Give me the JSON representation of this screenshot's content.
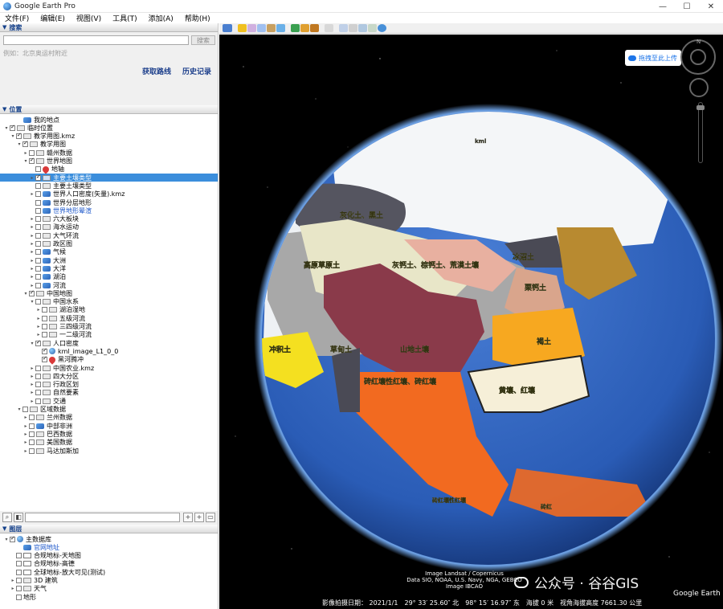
{
  "window": {
    "title": "Google Earth Pro",
    "controls": [
      "—",
      "☐",
      "✕"
    ]
  },
  "menu": [
    "文件(F)",
    "编辑(E)",
    "视图(V)",
    "工具(T)",
    "添加(A)",
    "帮助(H)"
  ],
  "search": {
    "header": "搜索",
    "button": "搜索",
    "hint": "例如：北京奥运村附近",
    "links": [
      "获取路线",
      "历史记录"
    ]
  },
  "places": {
    "header": "位置",
    "items": [
      {
        "label": "我的地点",
        "indent": 1,
        "icon": "layer",
        "expander": "",
        "check": "none"
      },
      {
        "label": "临时位置",
        "indent": 0,
        "icon": "folder",
        "expander": "▾",
        "check": "checked"
      },
      {
        "label": "教学用图.kmz",
        "indent": 1,
        "icon": "folder",
        "expander": "▾",
        "check": "checked"
      },
      {
        "label": "教学用图",
        "indent": 2,
        "icon": "folder",
        "expander": "▾",
        "check": "checked"
      },
      {
        "label": "赣州数据",
        "indent": 3,
        "icon": "folder",
        "expander": "▸",
        "check": "unchecked"
      },
      {
        "label": "世界地图",
        "indent": 3,
        "icon": "folder",
        "expander": "▾",
        "check": "checked"
      },
      {
        "label": "地轴",
        "indent": 4,
        "icon": "pin",
        "expander": "",
        "check": "unchecked"
      },
      {
        "label": "主要土壤类型",
        "indent": 4,
        "icon": "folder",
        "expander": "▸",
        "check": "checked",
        "selected": true
      },
      {
        "label": "主要土壤类型",
        "indent": 4,
        "icon": "folder",
        "expander": "",
        "check": "unchecked"
      },
      {
        "label": "世界人口密度(矢量).kmz",
        "indent": 4,
        "icon": "layer",
        "expander": "▸",
        "check": "unchecked"
      },
      {
        "label": "世界分层地形",
        "indent": 4,
        "icon": "layer",
        "expander": "",
        "check": "unchecked"
      },
      {
        "label": "世界地形晕渲",
        "indent": 4,
        "icon": "layer",
        "expander": "",
        "check": "unchecked",
        "blue": true
      },
      {
        "label": "六大板块",
        "indent": 4,
        "icon": "folder",
        "expander": "▸",
        "check": "unchecked"
      },
      {
        "label": "海水运动",
        "indent": 4,
        "icon": "folder",
        "expander": "▸",
        "check": "unchecked"
      },
      {
        "label": "大气环流",
        "indent": 4,
        "icon": "folder",
        "expander": "▸",
        "check": "unchecked"
      },
      {
        "label": "政区图",
        "indent": 4,
        "icon": "folder",
        "expander": "▸",
        "check": "unchecked"
      },
      {
        "label": "气候",
        "indent": 4,
        "icon": "layer",
        "expander": "▸",
        "check": "unchecked"
      },
      {
        "label": "大洲",
        "indent": 4,
        "icon": "layer",
        "expander": "▸",
        "check": "unchecked"
      },
      {
        "label": "大洋",
        "indent": 4,
        "icon": "layer",
        "expander": "▸",
        "check": "unchecked"
      },
      {
        "label": "湖泊",
        "indent": 4,
        "icon": "layer",
        "expander": "▸",
        "check": "unchecked"
      },
      {
        "label": "河流",
        "indent": 4,
        "icon": "layer",
        "expander": "▸",
        "check": "unchecked"
      },
      {
        "label": "中国地图",
        "indent": 3,
        "icon": "folder",
        "expander": "▾",
        "check": "checked"
      },
      {
        "label": "中国水系",
        "indent": 4,
        "icon": "folder",
        "expander": "▾",
        "check": "unchecked"
      },
      {
        "label": "湖泊湿地",
        "indent": 5,
        "icon": "folder",
        "expander": "▸",
        "check": "unchecked"
      },
      {
        "label": "五级河流",
        "indent": 5,
        "icon": "folder",
        "expander": "▸",
        "check": "unchecked"
      },
      {
        "label": "三四级河流",
        "indent": 5,
        "icon": "folder",
        "expander": "▸",
        "check": "unchecked"
      },
      {
        "label": "一二级河流",
        "indent": 5,
        "icon": "folder",
        "expander": "▸",
        "check": "unchecked"
      },
      {
        "label": "人口密度",
        "indent": 4,
        "icon": "folder",
        "expander": "▾",
        "check": "checked"
      },
      {
        "label": "kml_image_L1_0_0",
        "indent": 5,
        "icon": "globe",
        "expander": "",
        "check": "checked"
      },
      {
        "label": "黑河腾冲",
        "indent": 5,
        "icon": "pin",
        "expander": "",
        "check": "checked"
      },
      {
        "label": "中国农业.kmz",
        "indent": 4,
        "icon": "folder",
        "expander": "▸",
        "check": "unchecked"
      },
      {
        "label": "四大分区",
        "indent": 4,
        "icon": "folder",
        "expander": "▸",
        "check": "unchecked"
      },
      {
        "label": "行政区划",
        "indent": 4,
        "icon": "folder",
        "expander": "▸",
        "check": "unchecked"
      },
      {
        "label": "自然要素",
        "indent": 4,
        "icon": "folder",
        "expander": "▸",
        "check": "unchecked"
      },
      {
        "label": "交通",
        "indent": 4,
        "icon": "folder",
        "expander": "▸",
        "check": "unchecked"
      },
      {
        "label": "区域数据",
        "indent": 2,
        "icon": "folder",
        "expander": "▾",
        "check": "unchecked"
      },
      {
        "label": "兰州数据",
        "indent": 3,
        "icon": "folder",
        "expander": "▸",
        "check": "unchecked"
      },
      {
        "label": "中部非洲",
        "indent": 3,
        "icon": "layer",
        "expander": "▸",
        "check": "unchecked"
      },
      {
        "label": "巴西数据",
        "indent": 3,
        "icon": "folder",
        "expander": "▸",
        "check": "unchecked"
      },
      {
        "label": "美国数据",
        "indent": 3,
        "icon": "folder",
        "expander": "▸",
        "check": "unchecked"
      },
      {
        "label": "马达加斯加",
        "indent": 3,
        "icon": "folder",
        "expander": "▸",
        "check": "unchecked"
      }
    ]
  },
  "layers": {
    "header": "图层",
    "items": [
      {
        "label": "主数据库",
        "indent": 0,
        "icon": "globe",
        "expander": "▾",
        "check": "checked"
      },
      {
        "label": "官网地址",
        "indent": 1,
        "icon": "layer",
        "expander": "",
        "check": "none",
        "blue": true
      },
      {
        "label": "合规地标-天地图",
        "indent": 1,
        "icon": "img",
        "expander": "",
        "check": "unchecked"
      },
      {
        "label": "合规地标-高德",
        "indent": 1,
        "icon": "img",
        "expander": "",
        "check": "unchecked"
      },
      {
        "label": "全球地标-放大可见(测试)",
        "indent": 1,
        "icon": "img",
        "expander": "",
        "check": "unchecked"
      },
      {
        "label": "3D 建筑",
        "indent": 1,
        "icon": "folder",
        "expander": "▸",
        "check": "unchecked"
      },
      {
        "label": "天气",
        "indent": 1,
        "icon": "folder",
        "expander": "▸",
        "check": "unchecked"
      },
      {
        "label": "地形",
        "indent": 1,
        "icon": "none",
        "expander": "",
        "check": "unchecked"
      }
    ]
  },
  "map": {
    "upload_button": "拖拽至此上传",
    "compass_n": "N",
    "regions": [
      {
        "label": "冰沼土",
        "fill": "#4a4a55"
      },
      {
        "label": "灰钙土、棕钙土、荒漠土壤",
        "fill": "#e8b0a0"
      },
      {
        "label": "灰化土、黑土",
        "fill": "#555560"
      },
      {
        "label": "栗钙土",
        "fill": "#d9a58c"
      },
      {
        "label": "褐土",
        "fill": "#f7a820"
      },
      {
        "label": "黄壤、红壤",
        "fill": "#f6efd8"
      },
      {
        "label": "山地土壤",
        "fill": "#8a3a4a"
      },
      {
        "label": "砖红壤性红壤、砖红壤",
        "fill": "#f26a20"
      },
      {
        "label": "高原草原土",
        "fill": "#e8e6c8"
      },
      {
        "label": "冲积土",
        "fill": "#f4e020"
      },
      {
        "label": "草甸土",
        "fill": "#a8a8a8"
      },
      {
        "label": "砖红壤性红壤",
        "fill": "#f26a20"
      },
      {
        "label": "kml",
        "fill": "#666666"
      },
      {
        "label": "砖红",
        "fill": "#f26a20"
      }
    ],
    "attribution": [
      "Image Landsat / Copernicus",
      "Data SIO, NOAA, U.S. Navy, NGA, GEBCO",
      "Image IBCAO"
    ],
    "logo": "Google Earth",
    "watermark": "公众号 · 谷谷GIS",
    "status": {
      "imagery_date": "影像拍摄日期： 2021/1/1",
      "lat": "29° 33′ 25.60″ 北",
      "lon": "98° 15′ 16.97″ 东",
      "elevation": "海拔      0 米",
      "eye_alt": "视角海拔高度 7661.30 公里"
    }
  },
  "colors": {
    "selection": "#3b8edc",
    "link_blue": "#1a55c9",
    "ocean": "#2a5cb6"
  }
}
